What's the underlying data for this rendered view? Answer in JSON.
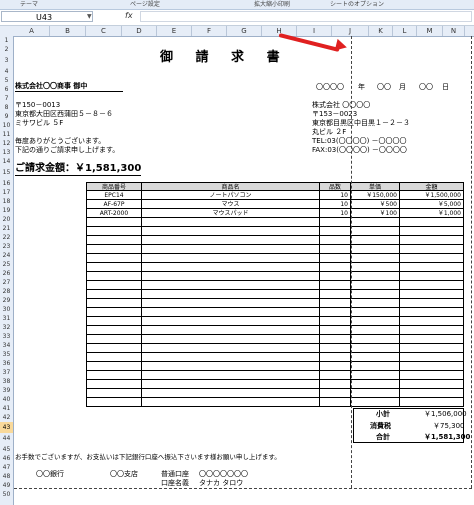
{
  "ribbon": {
    "theme": "テーマ",
    "page_setup": "ページ設定",
    "scale": "拡大縮小印刷",
    "sheet_options": "シートのオプション"
  },
  "formula_bar": {
    "name_box": "U43",
    "fx": "fx",
    "value": ""
  },
  "columns": [
    "A",
    "B",
    "C",
    "D",
    "E",
    "F",
    "G",
    "H",
    "I",
    "J",
    "K",
    "L",
    "M",
    "N"
  ],
  "rows": [
    "1",
    "2",
    "3",
    "4",
    "5",
    "6",
    "7",
    "8",
    "9",
    "10",
    "11",
    "12",
    "13",
    "14",
    "15",
    "16",
    "17",
    "18",
    "19",
    "20",
    "21",
    "22",
    "23",
    "24",
    "25",
    "26",
    "27",
    "28",
    "29",
    "30",
    "31",
    "32",
    "33",
    "34",
    "35",
    "36",
    "37",
    "38",
    "39",
    "40",
    "41",
    "42",
    "43",
    "44",
    "45",
    "46",
    "47",
    "48",
    "49",
    "50"
  ],
  "selected_row": "43",
  "invoice": {
    "title": "御 請 求 書",
    "customer": "株式会社〇〇商事 御中",
    "date_label": "〇〇〇〇",
    "year": "年",
    "date_cells": [
      "〇〇",
      "〇〇"
    ],
    "month": "月",
    "day": "日",
    "cust_zip": "〒150－0013",
    "cust_addr1": "東京都大田区西蒲田５－８－６",
    "cust_addr2": "ミサワビル ５F",
    "issuer_name": "株式会社 〇〇〇〇",
    "issuer_zip": "〒153－0023",
    "issuer_addr1": "東京都目黒区中目黒１－２－３",
    "issuer_addr2": "丸ビル ２F",
    "issuer_tel": "TEL:03(〇〇〇〇) －〇〇〇〇",
    "issuer_fax": "FAX:03(〇〇〇〇) －〇〇〇〇",
    "thanks1": "毎度ありがとうございます。",
    "thanks2": "下記の通りご請求申し上げます。",
    "total_label": "ご請求金額：￥1,581,300"
  },
  "table": {
    "headers": [
      "商品番号",
      "商品名",
      "品数",
      "単価",
      "金額"
    ],
    "items": [
      {
        "code": "EPC14",
        "name": "ノートパソコン",
        "qty": "10",
        "unit": "￥150,000",
        "amount": "￥1,500,000"
      },
      {
        "code": "AF-67P",
        "name": "マウス",
        "qty": "10",
        "unit": "￥500",
        "amount": "￥5,000"
      },
      {
        "code": "ART-2000",
        "name": "マウスパッド",
        "qty": "10",
        "unit": "￥100",
        "amount": "￥1,000"
      }
    ]
  },
  "totals": {
    "subtotal_label": "小計",
    "subtotal": "￥1,506,000",
    "tax_label": "消費税",
    "tax": "￥75,300",
    "total_label": "合計",
    "total": "￥1,581,300"
  },
  "footer": {
    "note": "お手数でございますが、お支払いは下記銀行口座へ振込下さいます様お願い申し上げます。",
    "bank": "〇〇銀行",
    "branch": "〇〇支店",
    "account_type": "普通口座",
    "account_no": "〇〇〇〇〇〇〇",
    "holder_label": "口座名義",
    "holder": "タナカ タロウ"
  }
}
